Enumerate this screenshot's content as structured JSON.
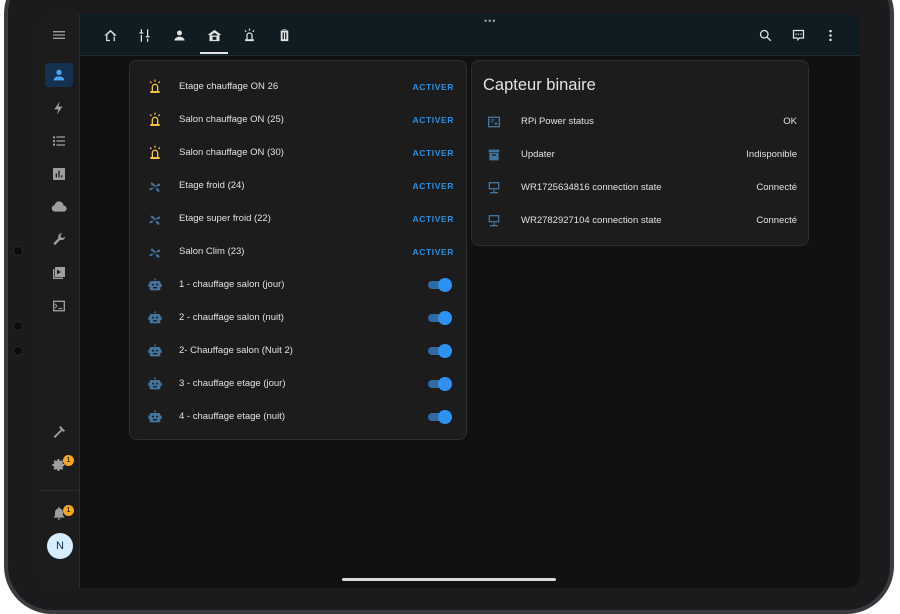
{
  "sidebar": {
    "items": [
      {
        "icon": "person-icon",
        "name": "sidebar-item-person"
      },
      {
        "icon": "flash-icon",
        "name": "sidebar-item-energy"
      },
      {
        "icon": "list-icon",
        "name": "sidebar-item-logbook"
      },
      {
        "icon": "chart-icon",
        "name": "sidebar-item-history"
      },
      {
        "icon": "cloud-icon",
        "name": "sidebar-item-cloud"
      },
      {
        "icon": "wrench-icon",
        "name": "sidebar-item-tools"
      },
      {
        "icon": "media-icon",
        "name": "sidebar-item-media"
      },
      {
        "icon": "terminal-icon",
        "name": "sidebar-item-terminal"
      }
    ],
    "settings_badge": "1",
    "notifications_badge": "1",
    "avatar_initial": "N"
  },
  "topbar": {
    "tabs": [
      "home-icon",
      "sliders-icon",
      "person-icon",
      "house-icon",
      "siren-icon",
      "trash-icon"
    ],
    "active_tab": 3,
    "dots": "•••"
  },
  "left_card": {
    "rows": [
      {
        "label": "Etage chauffage ON 26",
        "icon": "siren-icon",
        "action": "ACTIVER",
        "type": "script"
      },
      {
        "label": "Salon chauffage ON (25)",
        "icon": "siren-icon",
        "action": "ACTIVER",
        "type": "script"
      },
      {
        "label": "Salon chauffage ON (30)",
        "icon": "siren-icon",
        "action": "ACTIVER",
        "type": "script"
      },
      {
        "label": "Etage froid (24)",
        "icon": "fan-icon",
        "action": "ACTIVER",
        "type": "script"
      },
      {
        "label": "Etage super froid (22)",
        "icon": "fan-icon",
        "action": "ACTIVER",
        "type": "script"
      },
      {
        "label": "Salon Clim (23)",
        "icon": "fan-icon",
        "action": "ACTIVER",
        "type": "script"
      },
      {
        "label": "1 - chauffage salon (jour)",
        "icon": "robot-icon",
        "type": "toggle",
        "state": "on"
      },
      {
        "label": "2 - chauffage salon (nuit)",
        "icon": "robot-icon",
        "type": "toggle",
        "state": "on"
      },
      {
        "label": "2- Chauffage salon (Nuit 2)",
        "icon": "robot-icon",
        "type": "toggle",
        "state": "on"
      },
      {
        "label": "3 - chauffage etage (jour)",
        "icon": "robot-icon",
        "type": "toggle",
        "state": "on"
      },
      {
        "label": "4 - chauffage etage (nuit)",
        "icon": "robot-icon",
        "type": "toggle",
        "state": "on"
      }
    ]
  },
  "right_card": {
    "title": "Capteur binaire",
    "rows": [
      {
        "label": "RPi Power status",
        "icon": "raspberry-icon",
        "value": "OK"
      },
      {
        "label": "Updater",
        "icon": "package-icon",
        "value": "Indisponible"
      },
      {
        "label": "WR1725634816 connection state",
        "icon": "monitor-network-icon",
        "value": "Connecté"
      },
      {
        "label": "WR2782927104 connection state",
        "icon": "monitor-network-icon",
        "value": "Connecté"
      }
    ]
  },
  "colors": {
    "accent": "#2d8fe0",
    "icon_blue": "#44739e",
    "icon_on": "#f3c53e",
    "badge": "#f5a623"
  }
}
